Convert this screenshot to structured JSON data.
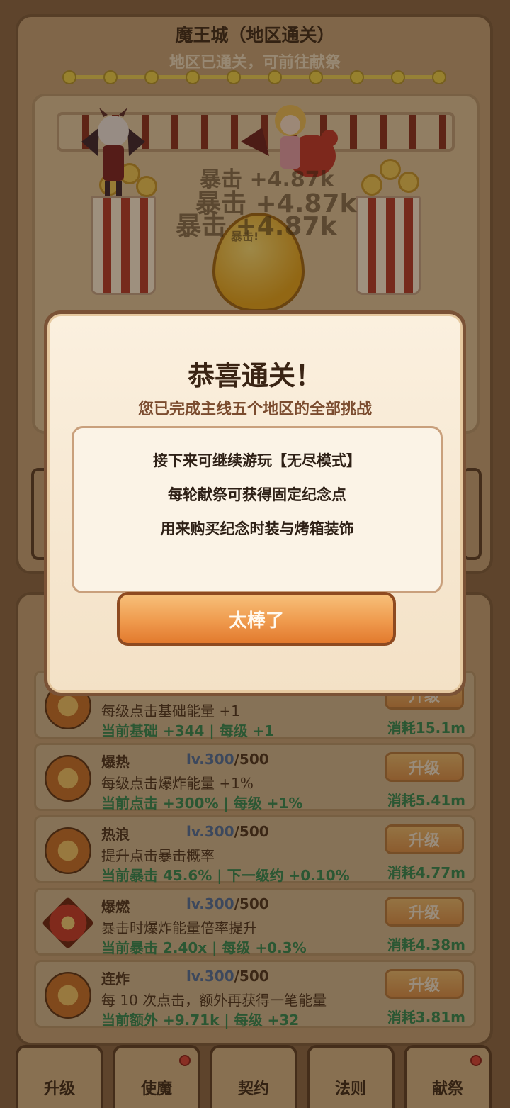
{
  "region": {
    "title": "魔王城（地区通关）",
    "subtitle": "地区已通关，可前往献祭"
  },
  "battle": {
    "damage_texts": [
      "暴击 +4.87k",
      "暴击 +4.87k",
      "暴击!"
    ]
  },
  "upgrades": [
    {
      "name": "",
      "level": "",
      "max": "",
      "desc": "每级点击基础能量 +1",
      "stat": "当前基础 +344 | 每级 +1",
      "button": "升级",
      "cost": "消耗15.1m"
    },
    {
      "name": "爆热",
      "level": "lv.300",
      "max": "/500",
      "desc": "每级点击爆炸能量 +1%",
      "stat": "当前点击 +300% | 每级 +1%",
      "button": "升级",
      "cost": "消耗5.41m"
    },
    {
      "name": "热浪",
      "level": "lv.300",
      "max": "/500",
      "desc": "提升点击暴击概率",
      "stat": "当前暴击 45.6% | 下一级约 +0.10%",
      "button": "升级",
      "cost": "消耗4.77m"
    },
    {
      "name": "爆燃",
      "level": "lv.300",
      "max": "/500",
      "desc": "暴击时爆炸能量倍率提升",
      "stat": "当前暴击 2.40x | 每级 +0.3%",
      "button": "升级",
      "cost": "消耗4.38m"
    },
    {
      "name": "连炸",
      "level": "lv.300",
      "max": "/500",
      "desc": "每 10 次点击，额外再获得一笔能量",
      "stat": "当前额外 +9.71k | 每级 +32",
      "button": "升级",
      "cost": "消耗3.81m"
    }
  ],
  "tabs": [
    {
      "label": "升级",
      "badge": false
    },
    {
      "label": "使魔",
      "badge": true
    },
    {
      "label": "契约",
      "badge": false
    },
    {
      "label": "法则",
      "badge": false
    },
    {
      "label": "献祭",
      "badge": true
    }
  ],
  "modal": {
    "title": "恭喜通关！",
    "subtitle": "您已完成主线五个地区的全部挑战",
    "lines": [
      "接下来可继续游玩【无尽模式】",
      "每轮献祭可获得固定纪念点",
      "用来购买纪念时装与烤箱装饰"
    ],
    "button": "太棒了"
  },
  "colors": {
    "accent": "#e27a2e",
    "panel": "#c9a77c",
    "stat_green": "#2f8a55",
    "badge_red": "#d9423a"
  }
}
